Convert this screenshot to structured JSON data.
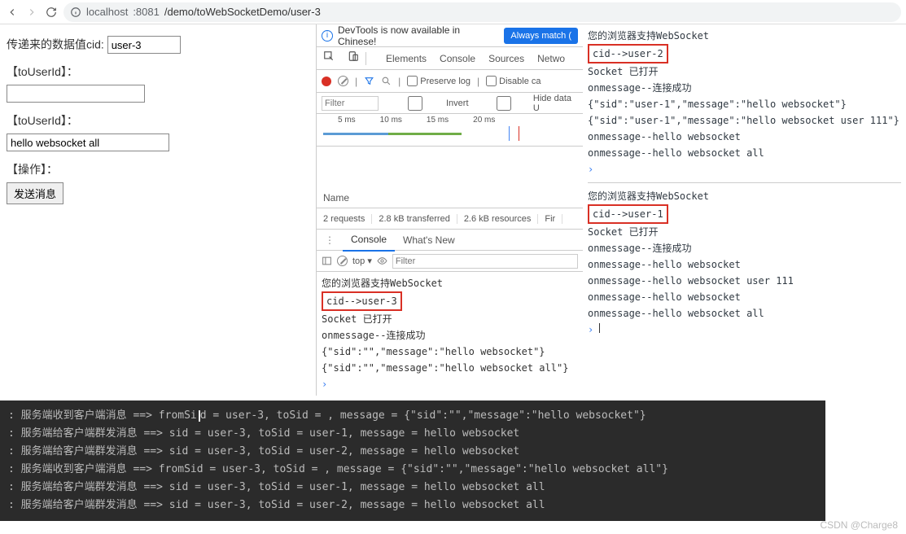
{
  "browser": {
    "url_host": "localhost",
    "url_port": ":8081",
    "url_path": "/demo/toWebSocketDemo/user-3"
  },
  "page": {
    "label_cid": "传递来的数据值cid:",
    "cid_value": "user-3",
    "label_toUserId1": "【toUserId】：",
    "input1_value": "",
    "label_toUserId2": "【toUserId】：",
    "input2_value": "hello websocket all",
    "label_op": "【操作】：",
    "btn_send": "发送消息"
  },
  "devtools": {
    "banner_text": "DevTools is now available in Chinese!",
    "banner_btn": "Always match (",
    "tabs": {
      "elements": "Elements",
      "console": "Console",
      "sources": "Sources",
      "network": "Netwo"
    },
    "preserve_log": "Preserve log",
    "disable_cache": "Disable ca",
    "filter_placeholder": "Filter",
    "invert": "Invert",
    "hide_data": "Hide data U",
    "wf_ticks": [
      "5 ms",
      "10 ms",
      "15 ms",
      "20 ms"
    ],
    "name_header": "Name",
    "stats": {
      "requests": "2 requests",
      "transferred": "2.8 kB transferred",
      "resources": "2.6 kB resources",
      "finish": "Fir"
    },
    "tabs2": {
      "console": "Console",
      "whatsnew": "What's New"
    },
    "cfilter": {
      "top": "top",
      "filter": "Filter"
    },
    "console_lines": [
      {
        "t": "您的浏览器支持WebSocket"
      },
      {
        "t": "cid-->user-3",
        "boxed": true
      },
      {
        "t": "Socket 已打开"
      },
      {
        "t": "onmessage--连接成功"
      },
      {
        "t": "{\"sid\":\"\",\"message\":\"hello websocket\"}"
      },
      {
        "t": "{\"sid\":\"\",\"message\":\"hello websocket all\"}"
      }
    ]
  },
  "right_consoles": {
    "a": [
      {
        "t": "您的浏览器支持WebSocket"
      },
      {
        "t": "cid-->user-2",
        "boxed": true
      },
      {
        "t": "Socket 已打开"
      },
      {
        "t": "onmessage--连接成功"
      },
      {
        "t": "{\"sid\":\"user-1\",\"message\":\"hello websocket\"}"
      },
      {
        "t": "{\"sid\":\"user-1\",\"message\":\"hello websocket user 111\"}"
      },
      {
        "t": "onmessage--hello websocket"
      },
      {
        "t": "onmessage--hello websocket all"
      }
    ],
    "b": [
      {
        "t": "您的浏览器支持WebSocket"
      },
      {
        "t": "cid-->user-1",
        "boxed": true
      },
      {
        "t": "Socket 已打开"
      },
      {
        "t": "onmessage--连接成功"
      },
      {
        "t": "onmessage--hello websocket"
      },
      {
        "t": "onmessage--hello websocket user 111"
      },
      {
        "t": "onmessage--hello websocket"
      },
      {
        "t": "onmessage--hello websocket all"
      }
    ]
  },
  "terminal": [
    ": 服务端收到客户端消息 ==> fromSi|d = user-3, toSid = , message = {\"sid\":\"\",\"message\":\"hello websocket\"}",
    ": 服务端给客户端群发消息 ==> sid = user-3, toSid = user-1, message = hello websocket",
    ": 服务端给客户端群发消息 ==> sid = user-3, toSid = user-2, message = hello websocket",
    ": 服务端收到客户端消息 ==> fromSid = user-3, toSid = , message = {\"sid\":\"\",\"message\":\"hello websocket all\"}",
    ": 服务端给客户端群发消息 ==> sid = user-3, toSid = user-1, message = hello websocket all",
    ": 服务端给客户端群发消息 ==> sid = user-3, toSid = user-2, message = hello websocket all"
  ],
  "watermark": "CSDN @Charge8"
}
